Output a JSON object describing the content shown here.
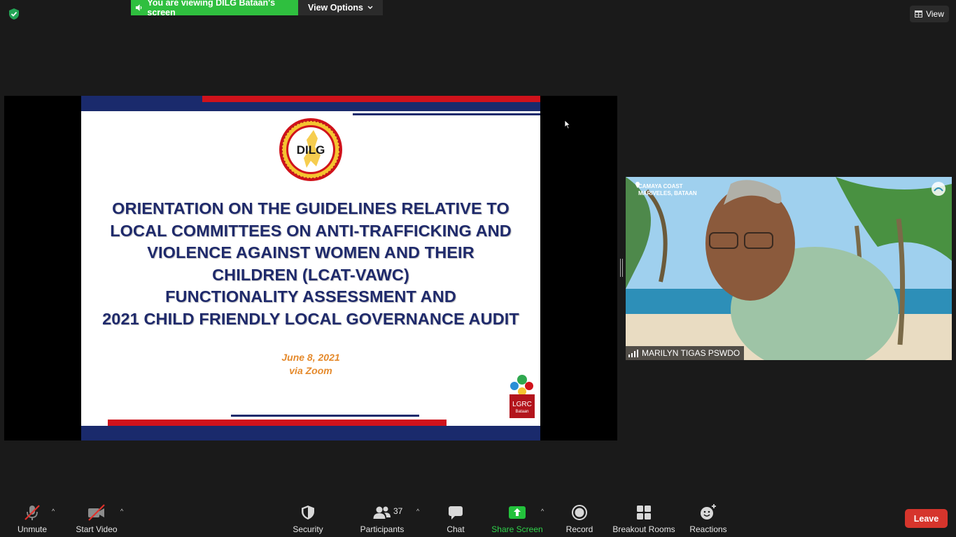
{
  "top_bar": {
    "viewing_text": "You are viewing DILG Bataan's screen",
    "view_options_label": "View Options",
    "view_label": "View"
  },
  "slide": {
    "logo_text": "DILG",
    "title_lines": [
      "ORIENTATION ON THE GUIDELINES RELATIVE TO",
      "LOCAL COMMITTEES ON ANTI-TRAFFICKING AND",
      "VIOLENCE AGAINST WOMEN AND THEIR",
      "CHILDREN (LCAT-VAWC)",
      "FUNCTIONALITY ASSESSMENT AND",
      "2021 CHILD FRIENDLY LOCAL GOVERNANCE AUDIT"
    ],
    "date": "June 8, 2021",
    "via": "via Zoom",
    "lgrc_logo_text": "LGRC",
    "lgrc_logo_sub": "Bataan",
    "colors": {
      "navy": "#1a2a6c",
      "red": "#d0121b",
      "orange": "#e58a2c"
    }
  },
  "participant": {
    "name": "MARILYN TIGAS PSWDO",
    "location_line1": "CAMAYA COAST",
    "location_line2": "MARIVELES, BATAAN"
  },
  "toolbar": {
    "unmute": "Unmute",
    "start_video": "Start Video",
    "security": "Security",
    "participants": "Participants",
    "participants_count": "37",
    "chat": "Chat",
    "share_screen": "Share Screen",
    "record": "Record",
    "breakout_rooms": "Breakout Rooms",
    "reactions": "Reactions",
    "leave": "Leave"
  }
}
